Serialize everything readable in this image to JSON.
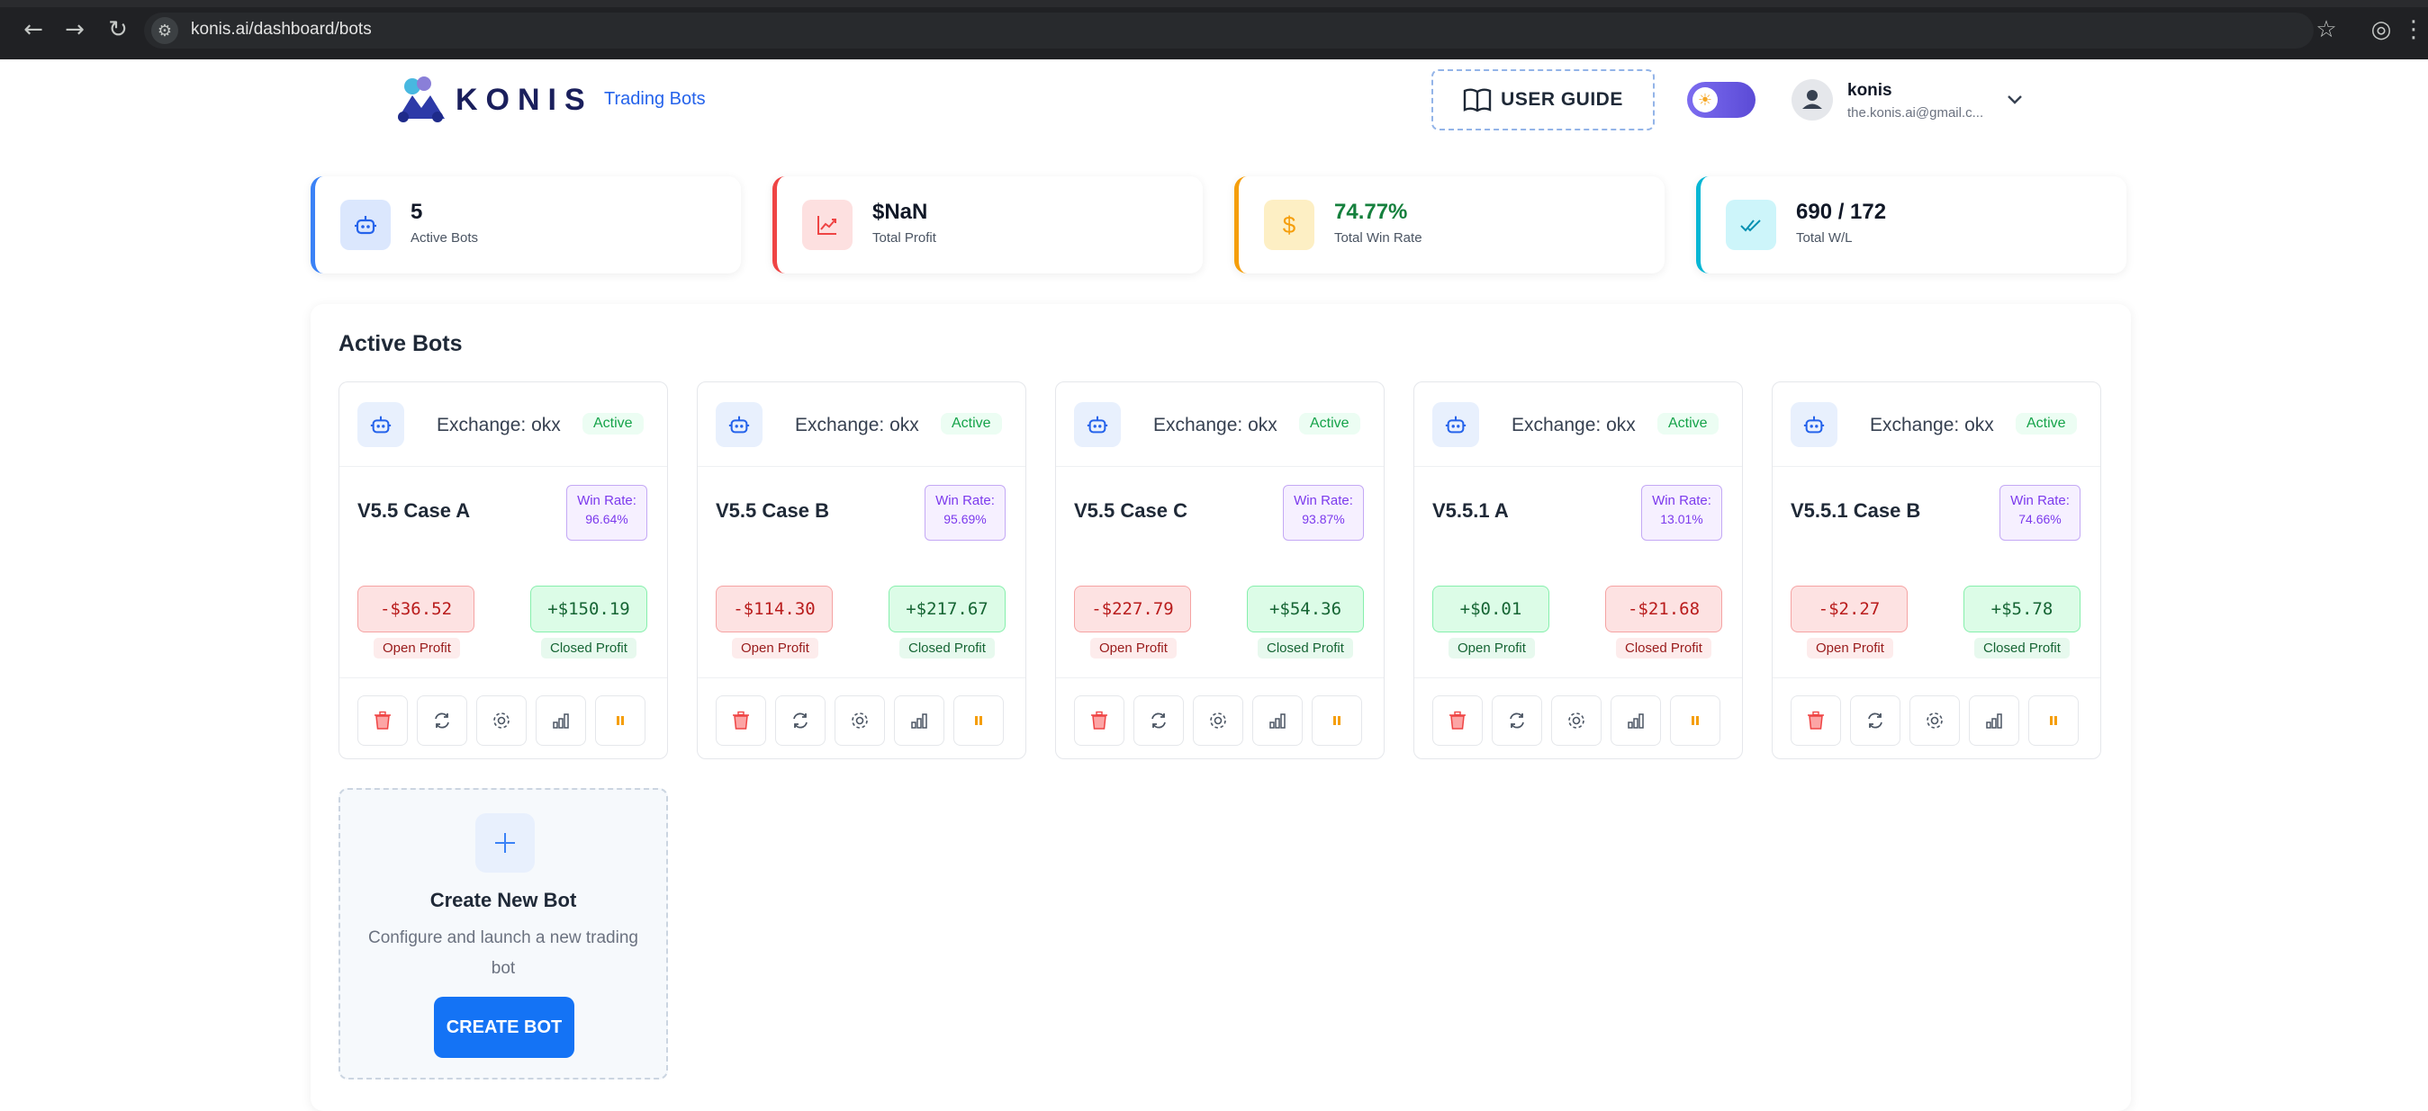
{
  "browser": {
    "url": "konis.ai/dashboard/bots"
  },
  "header": {
    "logo_text": "KONIS",
    "nav_link": "Trading Bots",
    "user_guide_label": "USER GUIDE",
    "user": {
      "name": "konis",
      "email": "the.konis.ai@gmail.c..."
    }
  },
  "stats": [
    {
      "value": "5",
      "label": "Active Bots",
      "color": "#3b82f6"
    },
    {
      "value": "$NaN",
      "label": "Total Profit",
      "color": "#ef4444"
    },
    {
      "value": "74.77%",
      "label": "Total Win Rate",
      "color": "#f59e0b"
    },
    {
      "value": "690 / 172",
      "label": "Total W/L",
      "color": "#06b6d4"
    }
  ],
  "main": {
    "title": "Active Bots",
    "bots": [
      {
        "exchange": "Exchange: okx",
        "status": "Active",
        "name": "V5.5 Case A",
        "win_rate_label": "Win Rate:",
        "win_rate": "96.64%",
        "open_profit": "-$36.52",
        "closed_profit": "+$150.19",
        "open_label": "Open Profit",
        "closed_label": "Closed Profit"
      },
      {
        "exchange": "Exchange: okx",
        "status": "Active",
        "name": "V5.5 Case B",
        "win_rate_label": "Win Rate:",
        "win_rate": "95.69%",
        "open_profit": "-$114.30",
        "closed_profit": "+$217.67",
        "open_label": "Open Profit",
        "closed_label": "Closed Profit"
      },
      {
        "exchange": "Exchange: okx",
        "status": "Active",
        "name": "V5.5 Case C",
        "win_rate_label": "Win Rate:",
        "win_rate": "93.87%",
        "open_profit": "-$227.79",
        "closed_profit": "+$54.36",
        "open_label": "Open Profit",
        "closed_label": "Closed Profit"
      },
      {
        "exchange": "Exchange: okx",
        "status": "Active",
        "name": "V5.5.1 A",
        "win_rate_label": "Win Rate:",
        "win_rate": "13.01%",
        "open_profit": "+$0.01",
        "closed_profit": "-$21.68",
        "open_label": "Open Profit",
        "closed_label": "Closed Profit"
      },
      {
        "exchange": "Exchange: okx",
        "status": "Active",
        "name": "V5.5.1 Case B",
        "win_rate_label": "Win Rate:",
        "win_rate": "74.66%",
        "open_profit": "-$2.27",
        "closed_profit": "+$5.78",
        "open_label": "Open Profit",
        "closed_label": "Closed Profit"
      }
    ],
    "create": {
      "title": "Create New Bot",
      "description": "Configure and launch a new trading bot",
      "button": "CREATE BOT"
    }
  }
}
